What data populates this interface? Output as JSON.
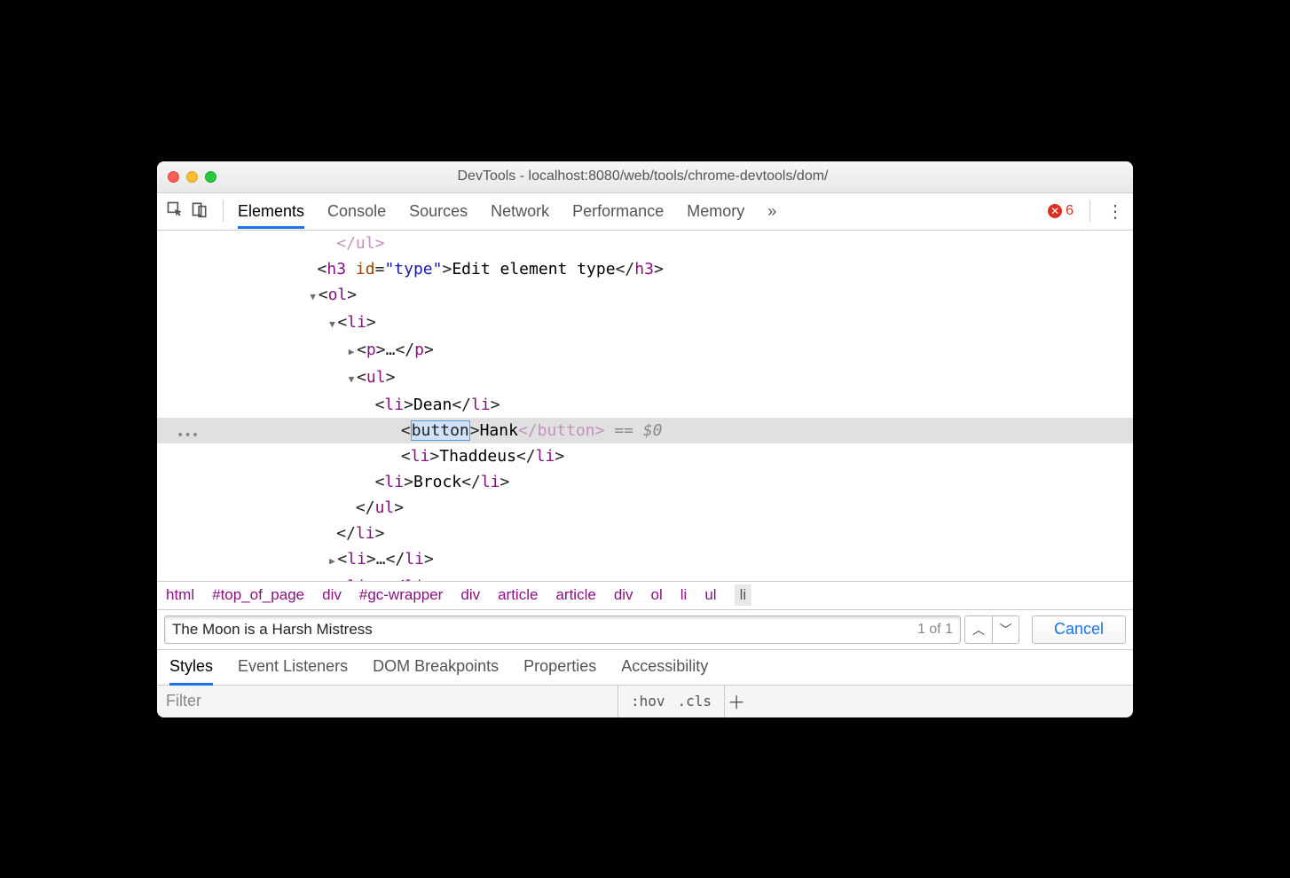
{
  "window": {
    "title": "DevTools - localhost:8080/web/tools/chrome-devtools/dom/"
  },
  "toolbar": {
    "tabs": [
      "Elements",
      "Console",
      "Sources",
      "Network",
      "Performance",
      "Memory"
    ],
    "overflow": "»",
    "error_count": "6"
  },
  "dom": {
    "line_close_ul": "</ul>",
    "h3_open_tag": "h3",
    "h3_attr_name": "id",
    "h3_attr_val": "\"type\"",
    "h3_text": "Edit element type",
    "ol_tag": "ol",
    "li_tag": "li",
    "p_tag": "p",
    "ellipsis": "…",
    "ul_tag": "ul",
    "items": [
      "Dean",
      "Hank",
      "Thaddeus",
      "Brock"
    ],
    "edit_tag": "button",
    "closing_button": "</button>",
    "dollar_ref": " == $0"
  },
  "crumb": [
    "html",
    "#top_of_page",
    "div",
    "#gc-wrapper",
    "div",
    "article",
    "article",
    "div",
    "ol",
    "li",
    "ul",
    "li"
  ],
  "search": {
    "value": "The Moon is a Harsh Mistress",
    "count": "1 of 1",
    "cancel": "Cancel"
  },
  "lowertabs": [
    "Styles",
    "Event Listeners",
    "DOM Breakpoints",
    "Properties",
    "Accessibility"
  ],
  "styles": {
    "filter_placeholder": "Filter",
    "hov": ":hov",
    "cls": ".cls"
  }
}
